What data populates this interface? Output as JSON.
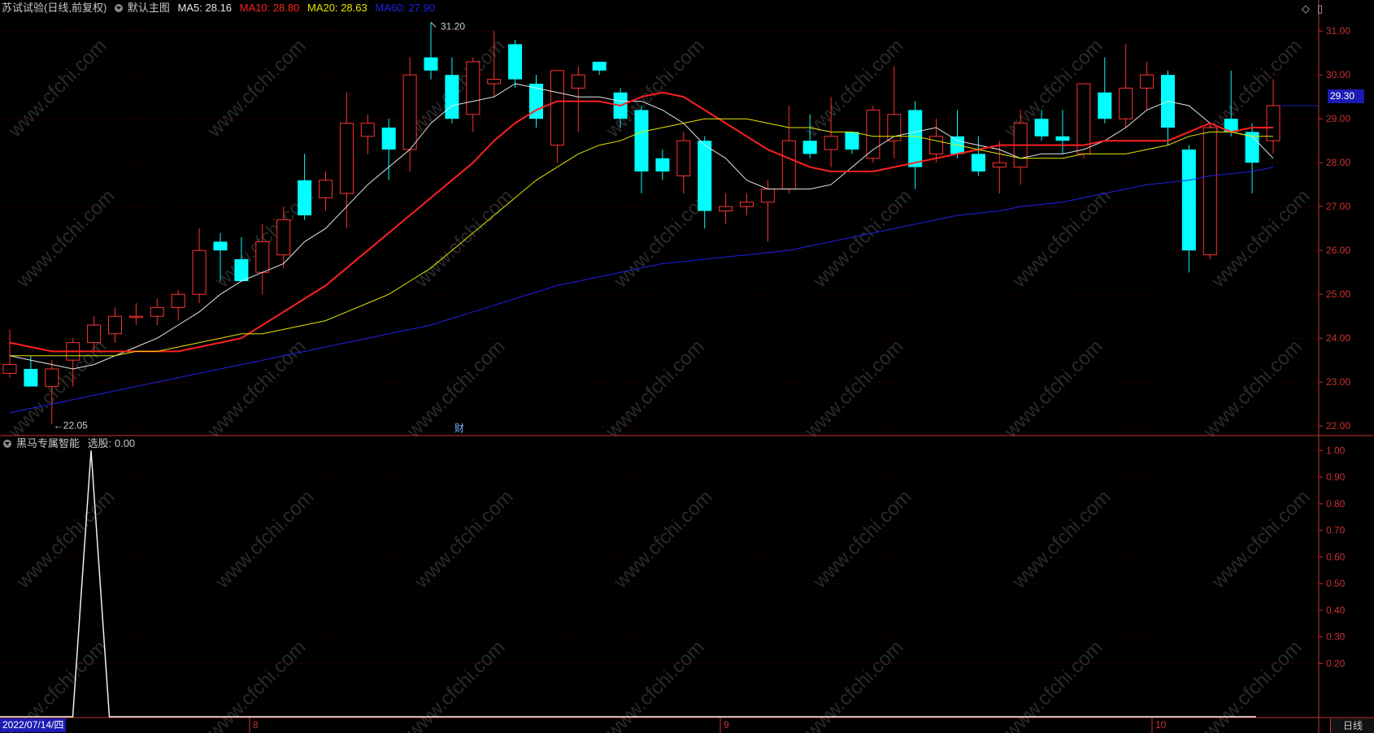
{
  "header": {
    "stock_title": "苏试试验(日线,前复权)",
    "main_chart_label": "默认主图",
    "ma_labels": [
      {
        "text": "MA5: 28.16",
        "color": "#e6e6e6"
      },
      {
        "text": "MA10: 28.80",
        "color": "#ff2020"
      },
      {
        "text": "MA20: 28.63",
        "color": "#e6e600"
      },
      {
        "text": "MA60: 27.90",
        "color": "#2020e6"
      }
    ],
    "sub_indicator_label": "黑马专属智能",
    "sub_value_text": "选股: 0.00"
  },
  "top_right_icons": [
    {
      "name": "diamond-icon",
      "glyph": "◇"
    },
    {
      "name": "menu-icon",
      "glyph": "▯"
    }
  ],
  "last_price_label": "29.30",
  "max_marker_label": "31.20",
  "min_marker_label": "←22.05",
  "event_marker": "财",
  "x_axis": {
    "date_box": "2022/07/14/四",
    "month_labels": [
      "8",
      "9",
      "10"
    ]
  },
  "period_button": "日线",
  "colors": {
    "up": "#ff3232",
    "down": "#00ffff",
    "ma5": "#e6e6e6",
    "ma10": "#ff2020",
    "ma20": "#e6e600",
    "ma60": "#2020e6",
    "axis": "#c83232",
    "grid": "#3a0000"
  },
  "chart_data": [
    {
      "type": "candlestick",
      "title": "苏试试验(日线,前复权)",
      "ylim": [
        21.8,
        31.3
      ],
      "y_ticks": [
        "22.00",
        "23.00",
        "24.00",
        "25.00",
        "26.00",
        "27.00",
        "28.00",
        "29.00",
        "30.00",
        "31.00"
      ],
      "candles": [
        {
          "o": 23.2,
          "h": 24.2,
          "l": 23.1,
          "c": 23.4
        },
        {
          "o": 23.3,
          "h": 23.6,
          "l": 22.9,
          "c": 22.9
        },
        {
          "o": 22.9,
          "h": 23.5,
          "l": 22.05,
          "c": 23.3
        },
        {
          "o": 23.5,
          "h": 24.0,
          "l": 22.9,
          "c": 23.9
        },
        {
          "o": 23.9,
          "h": 24.5,
          "l": 23.7,
          "c": 24.3
        },
        {
          "o": 24.1,
          "h": 24.7,
          "l": 23.9,
          "c": 24.5
        },
        {
          "o": 24.5,
          "h": 24.8,
          "l": 24.3,
          "c": 24.5
        },
        {
          "o": 24.5,
          "h": 24.9,
          "l": 24.3,
          "c": 24.7
        },
        {
          "o": 24.7,
          "h": 25.1,
          "l": 24.4,
          "c": 25.0
        },
        {
          "o": 25.0,
          "h": 26.5,
          "l": 24.8,
          "c": 26.0
        },
        {
          "o": 26.2,
          "h": 26.4,
          "l": 25.3,
          "c": 26.0
        },
        {
          "o": 25.8,
          "h": 26.3,
          "l": 25.3,
          "c": 25.3
        },
        {
          "o": 25.5,
          "h": 26.6,
          "l": 25.0,
          "c": 26.2
        },
        {
          "o": 25.9,
          "h": 27.0,
          "l": 25.6,
          "c": 26.7
        },
        {
          "o": 27.6,
          "h": 28.2,
          "l": 26.7,
          "c": 26.8
        },
        {
          "o": 27.2,
          "h": 27.8,
          "l": 26.9,
          "c": 27.6
        },
        {
          "o": 27.3,
          "h": 29.6,
          "l": 26.5,
          "c": 28.9
        },
        {
          "o": 28.6,
          "h": 29.1,
          "l": 28.2,
          "c": 28.9
        },
        {
          "o": 28.8,
          "h": 29.0,
          "l": 27.6,
          "c": 28.3
        },
        {
          "o": 28.3,
          "h": 30.4,
          "l": 27.8,
          "c": 30.0
        },
        {
          "o": 30.4,
          "h": 31.2,
          "l": 29.9,
          "c": 30.1
        },
        {
          "o": 30.0,
          "h": 30.4,
          "l": 28.9,
          "c": 29.0
        },
        {
          "o": 29.1,
          "h": 30.4,
          "l": 28.7,
          "c": 30.3
        },
        {
          "o": 29.8,
          "h": 31.0,
          "l": 29.5,
          "c": 29.9
        },
        {
          "o": 30.7,
          "h": 30.8,
          "l": 29.7,
          "c": 29.9
        },
        {
          "o": 29.8,
          "h": 30.0,
          "l": 28.8,
          "c": 29.0
        },
        {
          "o": 28.4,
          "h": 30.1,
          "l": 28.0,
          "c": 30.1
        },
        {
          "o": 29.7,
          "h": 30.2,
          "l": 28.7,
          "c": 30.0
        },
        {
          "o": 30.3,
          "h": 30.2,
          "l": 30.0,
          "c": 30.1
        },
        {
          "o": 29.6,
          "h": 29.7,
          "l": 28.8,
          "c": 29.0
        },
        {
          "o": 29.2,
          "h": 29.3,
          "l": 27.3,
          "c": 27.8
        },
        {
          "o": 28.1,
          "h": 28.3,
          "l": 27.6,
          "c": 27.8
        },
        {
          "o": 27.7,
          "h": 28.7,
          "l": 27.3,
          "c": 28.5
        },
        {
          "o": 28.5,
          "h": 28.6,
          "l": 26.5,
          "c": 26.9
        },
        {
          "o": 26.9,
          "h": 27.3,
          "l": 26.6,
          "c": 27.0
        },
        {
          "o": 27.0,
          "h": 27.3,
          "l": 26.8,
          "c": 27.1
        },
        {
          "o": 27.1,
          "h": 27.6,
          "l": 26.2,
          "c": 27.4
        },
        {
          "o": 27.4,
          "h": 29.3,
          "l": 27.3,
          "c": 28.5
        },
        {
          "o": 28.5,
          "h": 29.1,
          "l": 28.1,
          "c": 28.2
        },
        {
          "o": 28.3,
          "h": 29.5,
          "l": 27.9,
          "c": 28.6
        },
        {
          "o": 28.7,
          "h": 28.7,
          "l": 28.2,
          "c": 28.3
        },
        {
          "o": 28.1,
          "h": 29.3,
          "l": 28.0,
          "c": 29.2
        },
        {
          "o": 28.5,
          "h": 30.2,
          "l": 28.1,
          "c": 29.1
        },
        {
          "o": 29.2,
          "h": 29.4,
          "l": 27.4,
          "c": 27.9
        },
        {
          "o": 28.2,
          "h": 29.0,
          "l": 28.0,
          "c": 28.6
        },
        {
          "o": 28.6,
          "h": 29.2,
          "l": 28.1,
          "c": 28.2
        },
        {
          "o": 28.2,
          "h": 28.6,
          "l": 27.7,
          "c": 27.8
        },
        {
          "o": 27.9,
          "h": 28.5,
          "l": 27.3,
          "c": 28.0
        },
        {
          "o": 27.9,
          "h": 29.2,
          "l": 27.5,
          "c": 28.9
        },
        {
          "o": 29.0,
          "h": 29.2,
          "l": 28.5,
          "c": 28.6
        },
        {
          "o": 28.6,
          "h": 29.2,
          "l": 28.2,
          "c": 28.5
        },
        {
          "o": 28.2,
          "h": 29.8,
          "l": 28.1,
          "c": 29.8
        },
        {
          "o": 29.6,
          "h": 30.4,
          "l": 28.9,
          "c": 29.0
        },
        {
          "o": 29.0,
          "h": 30.7,
          "l": 28.8,
          "c": 29.7
        },
        {
          "o": 29.7,
          "h": 30.3,
          "l": 29.2,
          "c": 30.0
        },
        {
          "o": 30.0,
          "h": 30.1,
          "l": 28.4,
          "c": 28.8
        },
        {
          "o": 28.3,
          "h": 28.4,
          "l": 25.5,
          "c": 26.0
        },
        {
          "o": 25.9,
          "h": 28.9,
          "l": 25.8,
          "c": 28.8
        },
        {
          "o": 29.0,
          "h": 30.1,
          "l": 28.6,
          "c": 28.7
        },
        {
          "o": 28.7,
          "h": 28.9,
          "l": 27.3,
          "c": 28.0
        },
        {
          "o": 28.5,
          "h": 29.9,
          "l": 28.2,
          "c": 29.3
        }
      ],
      "series": [
        {
          "name": "MA5",
          "values": [
            23.6,
            23.5,
            23.4,
            23.3,
            23.4,
            23.6,
            23.8,
            24.0,
            24.3,
            24.6,
            25.0,
            25.3,
            25.5,
            25.7,
            26.2,
            26.5,
            27.0,
            27.5,
            27.9,
            28.3,
            28.9,
            29.3,
            29.4,
            29.5,
            29.8,
            29.7,
            29.6,
            29.5,
            29.5,
            29.4,
            29.4,
            29.2,
            28.9,
            28.4,
            28.1,
            27.6,
            27.4,
            27.4,
            27.4,
            27.5,
            27.9,
            28.3,
            28.6,
            28.7,
            28.8,
            28.5,
            28.4,
            28.3,
            28.1,
            28.2,
            28.2,
            28.3,
            28.5,
            28.8,
            29.2,
            29.4,
            29.3,
            28.9,
            28.7,
            28.6,
            28.1
          ]
        },
        {
          "name": "MA10",
          "values": [
            23.9,
            23.8,
            23.7,
            23.7,
            23.7,
            23.7,
            23.7,
            23.7,
            23.7,
            23.8,
            23.9,
            24.0,
            24.3,
            24.6,
            24.9,
            25.2,
            25.6,
            26.0,
            26.4,
            26.8,
            27.2,
            27.6,
            28.0,
            28.5,
            28.9,
            29.2,
            29.4,
            29.4,
            29.4,
            29.3,
            29.5,
            29.6,
            29.5,
            29.2,
            28.9,
            28.6,
            28.3,
            28.1,
            27.9,
            27.8,
            27.8,
            27.8,
            27.9,
            28.0,
            28.1,
            28.2,
            28.3,
            28.4,
            28.4,
            28.4,
            28.4,
            28.4,
            28.5,
            28.5,
            28.5,
            28.5,
            28.7,
            28.9,
            28.7,
            28.8,
            28.8
          ]
        },
        {
          "name": "MA20",
          "values": [
            23.6,
            23.6,
            23.6,
            23.6,
            23.6,
            23.6,
            23.7,
            23.7,
            23.8,
            23.9,
            24.0,
            24.1,
            24.1,
            24.2,
            24.3,
            24.4,
            24.6,
            24.8,
            25.0,
            25.3,
            25.6,
            26.0,
            26.4,
            26.8,
            27.2,
            27.6,
            27.9,
            28.2,
            28.4,
            28.5,
            28.7,
            28.8,
            28.9,
            29.0,
            29.0,
            29.0,
            28.9,
            28.8,
            28.8,
            28.7,
            28.7,
            28.6,
            28.6,
            28.6,
            28.5,
            28.4,
            28.3,
            28.2,
            28.1,
            28.1,
            28.1,
            28.2,
            28.2,
            28.2,
            28.3,
            28.4,
            28.6,
            28.7,
            28.7,
            28.6,
            28.6
          ]
        },
        {
          "name": "MA60",
          "values": [
            22.3,
            22.4,
            22.5,
            22.6,
            22.7,
            22.8,
            22.9,
            23.0,
            23.1,
            23.2,
            23.3,
            23.4,
            23.5,
            23.6,
            23.7,
            23.8,
            23.9,
            24.0,
            24.1,
            24.2,
            24.3,
            24.45,
            24.6,
            24.75,
            24.9,
            25.05,
            25.2,
            25.3,
            25.4,
            25.5,
            25.6,
            25.7,
            25.75,
            25.8,
            25.85,
            25.9,
            25.95,
            26.0,
            26.1,
            26.2,
            26.3,
            26.4,
            26.5,
            26.6,
            26.7,
            26.8,
            26.85,
            26.9,
            27.0,
            27.05,
            27.1,
            27.2,
            27.3,
            27.4,
            27.5,
            27.55,
            27.6,
            27.7,
            27.75,
            27.8,
            27.9
          ]
        }
      ],
      "annotations": [
        {
          "text": "31.20",
          "index": 20,
          "value": 31.2
        },
        {
          "text": "←22.05",
          "index": 2,
          "value": 22.05
        }
      ]
    },
    {
      "type": "line",
      "title": "黑马专属智能",
      "ylim": [
        0,
        1.05
      ],
      "y_ticks": [
        "0.20",
        "0.30",
        "0.40",
        "0.50",
        "0.60",
        "0.70",
        "0.80",
        "0.90",
        "1.00"
      ],
      "series": [
        {
          "name": "选股",
          "values": [
            0,
            0,
            0,
            0,
            1,
            0,
            0,
            0,
            0,
            0,
            0,
            0,
            0,
            0,
            0,
            0,
            0,
            0,
            0,
            0,
            0,
            0,
            0,
            0,
            0,
            0,
            0,
            0,
            0,
            0,
            0,
            0,
            0,
            0,
            0,
            0,
            0,
            0,
            0,
            0,
            0,
            0,
            0,
            0,
            0,
            0,
            0,
            0,
            0,
            0,
            0,
            0,
            0,
            0,
            0,
            0,
            0,
            0,
            0,
            0,
            0
          ]
        }
      ]
    }
  ]
}
